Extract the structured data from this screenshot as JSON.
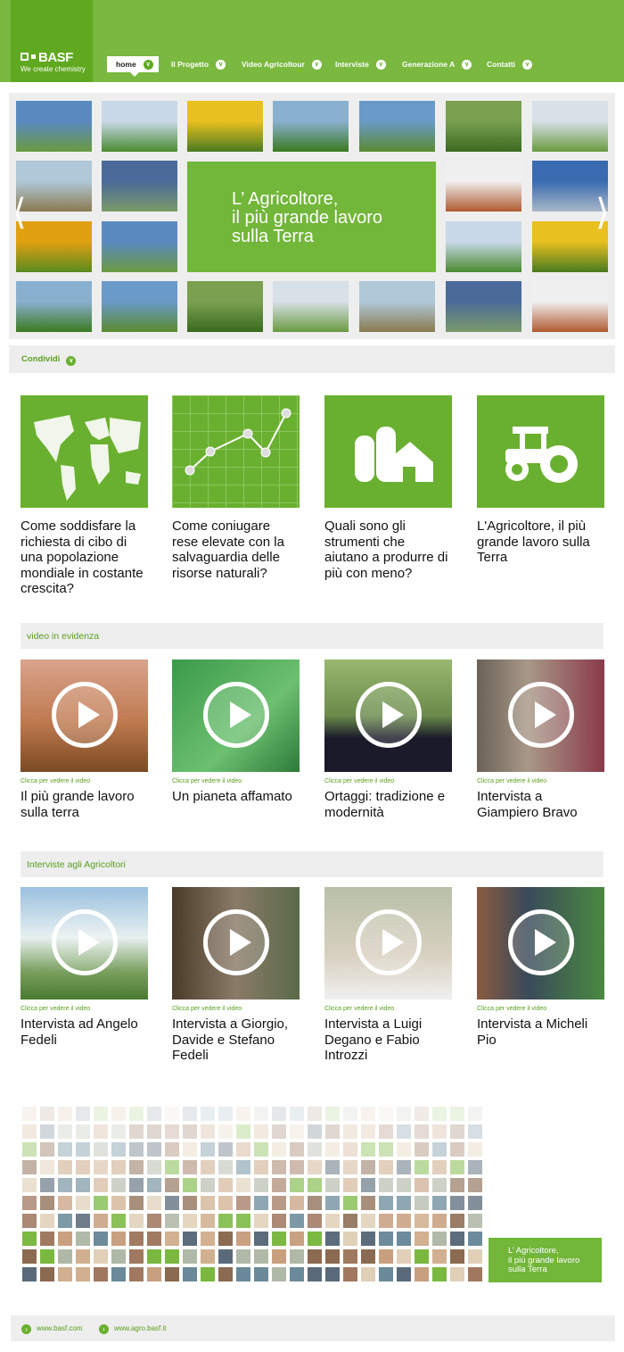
{
  "header": {
    "logo_text": "BASF",
    "tagline": "We create chemistry",
    "nav": [
      {
        "label": "home",
        "active": true
      },
      {
        "label": "Il Progetto"
      },
      {
        "label": "Video Agricoltour"
      },
      {
        "label": "Interviste"
      },
      {
        "label": "Generazione A"
      },
      {
        "label": "Contatti"
      }
    ]
  },
  "hero": {
    "title_line1": "L’ Agricoltore,",
    "title_line2": "il più grande lavoro",
    "title_line3": "sulla Terra"
  },
  "share": {
    "label": "Condividi"
  },
  "features": [
    {
      "title": "Come soddisfare la richiesta di cibo di una popolazione mondiale in costante crescita?",
      "icon": "world-map-icon"
    },
    {
      "title": "Come coniugare rese elevate con la salvaguardia delle risorse naturali?",
      "icon": "line-graph-icon"
    },
    {
      "title": "Quali sono gli strumenti che aiutano a produrre di più con meno?",
      "icon": "farm-silo-icon"
    },
    {
      "title": "L'Agricoltore, il più grande lavoro sulla Terra",
      "icon": "tractor-icon"
    }
  ],
  "videos_section": {
    "title": "video in evidenza",
    "caption": "Clicca per vedere il video",
    "items": [
      {
        "title": "Il più grande lavoro sulla terra"
      },
      {
        "title": "Un pianeta affamato"
      },
      {
        "title": "Ortaggi: tradizione e modernità"
      },
      {
        "title": "Intervista a Giampiero Bravo"
      }
    ]
  },
  "interviews_section": {
    "title": "Interviste agli Agricoltori",
    "caption": "Clicca per vedere il video",
    "items": [
      {
        "title": "Intervista ad Angelo Fedeli"
      },
      {
        "title": "Intervista a Giorgio, Davide e Stefano Fedeli"
      },
      {
        "title": "Intervista a Luigi Degano e Fabio Introzzi"
      },
      {
        "title": "Intervista a Micheli Pio"
      }
    ]
  },
  "faces_banner": {
    "line1": "L’ Agricoltore,",
    "line2": "il più grande lavoro",
    "line3": "sulla Terra"
  },
  "footer": {
    "links": [
      "www.basf.com",
      "www.agro.basf.it"
    ]
  },
  "colors": {
    "brand_green": "#7ab840",
    "dark_green": "#5fa81f",
    "text_green": "#5aa020",
    "panel_gray": "#eeeeee"
  }
}
